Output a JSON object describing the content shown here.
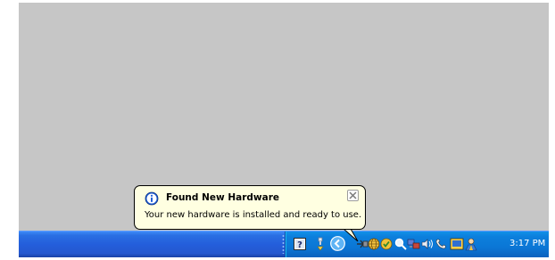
{
  "balloon": {
    "title": "Found New Hardware",
    "message": "Your new hardware is installed and ready to use.",
    "icon": "info-icon",
    "close_icon": "close-icon"
  },
  "tray": {
    "clock": "3:17 PM",
    "icons": [
      "help-icon",
      "usb-plug-icon",
      "show-hidden-icons-chevron",
      "usb-hardware-icon",
      "network-globe-icon",
      "security-shield-icon",
      "search-magnifier-icon",
      "network-computers-icon",
      "volume-speaker-icon",
      "phone-icon",
      "display-icon",
      "user-person-icon"
    ]
  },
  "colors": {
    "desktop": "#c6c6c6",
    "taskbar": "#245edb",
    "tray": "#0b77d6",
    "balloon": "#ffffe1"
  }
}
